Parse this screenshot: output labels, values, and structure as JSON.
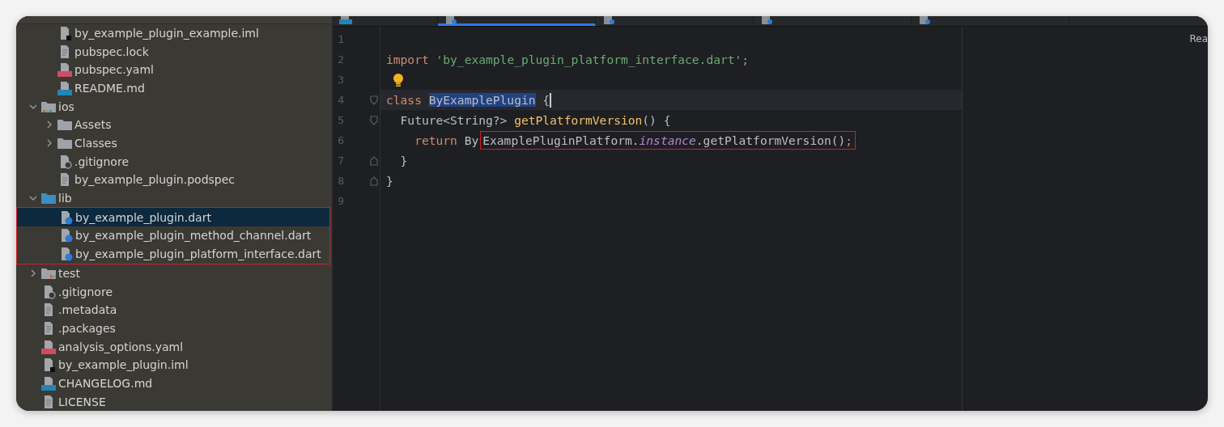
{
  "editor_tabs": [
    {
      "kind": "md",
      "selected": false
    },
    {
      "kind": "dart",
      "selected": true
    },
    {
      "kind": "dart",
      "selected": false
    },
    {
      "kind": "dart",
      "selected": false
    },
    {
      "kind": "dart",
      "selected": false
    }
  ],
  "reader_mode": "Rea",
  "tree": [
    {
      "children": [
        {
          "label": "by_example_plugin_example.iml",
          "kind": "iml",
          "selected": false
        },
        {
          "label": "pubspec.lock",
          "kind": "text",
          "selected": false
        },
        {
          "label": "pubspec.yaml",
          "kind": "yaml",
          "selected": false
        },
        {
          "label": "README.md",
          "kind": "md",
          "selected": false
        }
      ]
    },
    {
      "label": "ios",
      "kind": "ios-folder",
      "expanded": true,
      "selected": false,
      "children": [
        {
          "label": "Assets",
          "kind": "folder",
          "expanded": false,
          "selected": false
        },
        {
          "label": "Classes",
          "kind": "folder",
          "expanded": false,
          "selected": false
        },
        {
          "label": ".gitignore",
          "kind": "gitignore",
          "selected": false
        },
        {
          "label": "by_example_plugin.podspec",
          "kind": "text",
          "selected": false
        }
      ]
    },
    {
      "label": "lib",
      "kind": "source-folder",
      "expanded": true,
      "selected": false,
      "children": [
        {
          "label": "by_example_plugin.dart",
          "kind": "dart",
          "selected": true,
          "boxed": true
        },
        {
          "label": "by_example_plugin_method_channel.dart",
          "kind": "dart",
          "selected": false,
          "boxed": true
        },
        {
          "label": "by_example_plugin_platform_interface.dart",
          "kind": "dart",
          "selected": false,
          "boxed": true
        }
      ]
    },
    {
      "label": "test",
      "kind": "test-folder",
      "expanded": false,
      "selected": false
    },
    {
      "label": ".gitignore",
      "kind": "gitignore",
      "selected": false
    },
    {
      "label": ".metadata",
      "kind": "text",
      "selected": false
    },
    {
      "label": ".packages",
      "kind": "text",
      "selected": false
    },
    {
      "label": "analysis_options.yaml",
      "kind": "yaml",
      "selected": false
    },
    {
      "label": "by_example_plugin.iml",
      "kind": "iml",
      "selected": false
    },
    {
      "label": "CHANGELOG.md",
      "kind": "md",
      "selected": false
    },
    {
      "label": "LICENSE",
      "kind": "text",
      "selected": false
    }
  ],
  "code": [
    {
      "number": "1"
    },
    {
      "number": "2",
      "tokens": [
        {
          "text": "import ",
          "kind": "keyword"
        },
        {
          "text": "'by_example_plugin_platform_interface.dart'",
          "kind": "string"
        },
        {
          "text": ";",
          "kind": "keyword"
        }
      ]
    },
    {
      "number": "3",
      "bulb": true
    },
    {
      "number": "4",
      "current": true,
      "fold_open": true,
      "tokens": [
        {
          "text": "class ",
          "kind": "keyword"
        },
        {
          "text": "ByExamplePlugin",
          "kind": "selected"
        },
        {
          "text": " {",
          "kind": "plain"
        }
      ]
    },
    {
      "number": "5",
      "fold_open": true,
      "tokens": [
        {
          "text": "  Future<String?> ",
          "kind": "plain"
        },
        {
          "text": "getPlatformVersion",
          "kind": "method"
        },
        {
          "text": "() {",
          "kind": "plain"
        }
      ]
    },
    {
      "number": "6",
      "tokens": [
        {
          "text": "    return ",
          "kind": "keyword"
        },
        {
          "text": "By",
          "kind": "plain"
        }
      ],
      "boxed_tokens": [
        {
          "text": "ExamplePluginPlatform.",
          "kind": "plain"
        },
        {
          "text": "instance",
          "kind": "field"
        },
        {
          "text": ".getPlatformVersion()",
          "kind": "plain"
        },
        {
          "text": ";",
          "kind": "keyword"
        }
      ]
    },
    {
      "number": "7",
      "fold_close": true,
      "tokens": [
        {
          "text": "  }",
          "kind": "plain"
        }
      ]
    },
    {
      "number": "8",
      "fold_close": true,
      "tokens": [
        {
          "text": "}",
          "kind": "plain"
        }
      ]
    },
    {
      "number": "9"
    }
  ]
}
